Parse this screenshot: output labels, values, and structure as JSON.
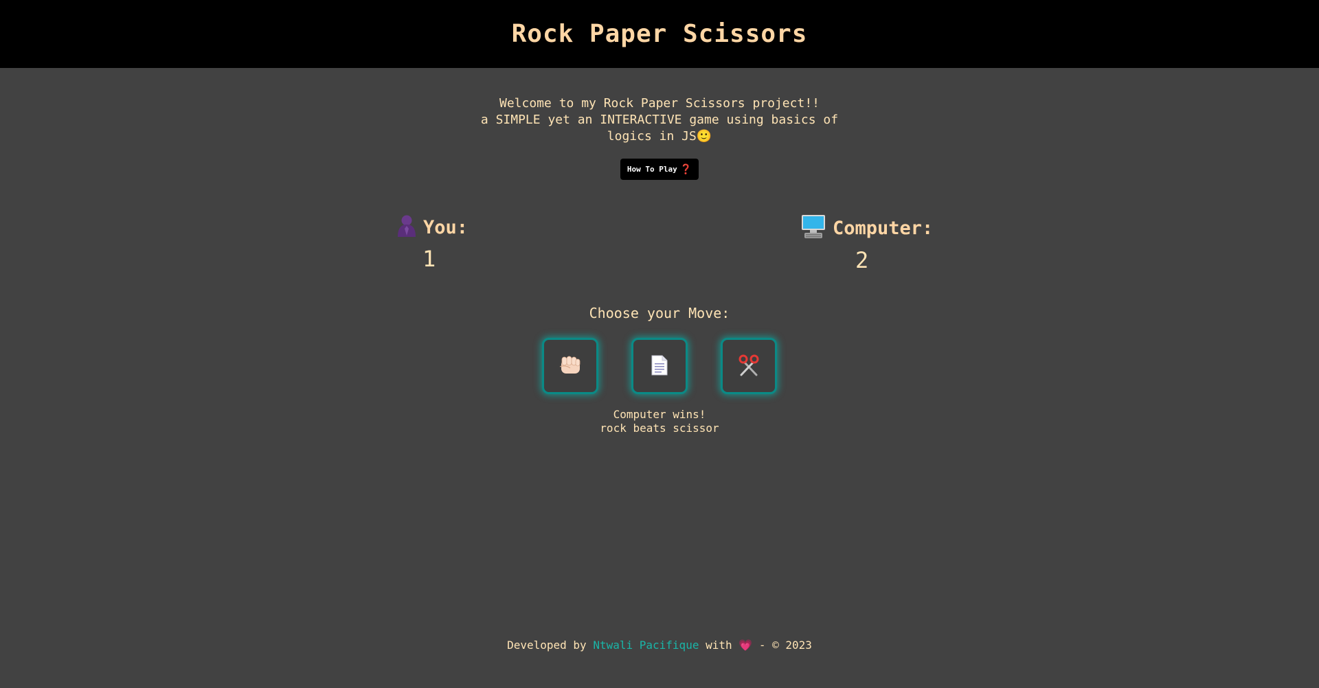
{
  "header": {
    "title": "Rock Paper Scissors"
  },
  "intro": {
    "line1": "Welcome to my Rock Paper Scissors project!!",
    "line2": "a SIMPLE yet an INTERACTIVE game using basics of",
    "line3": "logics in JS",
    "line3_emoji": "🙂"
  },
  "howto": {
    "label": "How To Play",
    "icon": "❓"
  },
  "scoreboard": {
    "you": {
      "label": "You:",
      "score": "1",
      "icon": "user-silhouette-icon"
    },
    "computer": {
      "label": "Computer:",
      "score": "2",
      "icon": "computer-icon"
    }
  },
  "moves": {
    "title": "Choose your Move:",
    "options": [
      {
        "name": "rock",
        "icon": "fist-icon"
      },
      {
        "name": "paper",
        "icon": "page-icon"
      },
      {
        "name": "scissors",
        "icon": "scissors-icon"
      }
    ]
  },
  "result": {
    "line1": "Computer wins!",
    "line2": "rock beats scissor"
  },
  "footer": {
    "prefix": "Developed by",
    "author": "Ntwali Pacifique",
    "with": "with",
    "heart": "💗",
    "suffix": "- © 2023"
  },
  "colors": {
    "background": "#424242",
    "header_bg": "#000000",
    "text": "#ffe4b5",
    "accent": "#1ab5a8",
    "button_glow": "#0a8a86"
  }
}
